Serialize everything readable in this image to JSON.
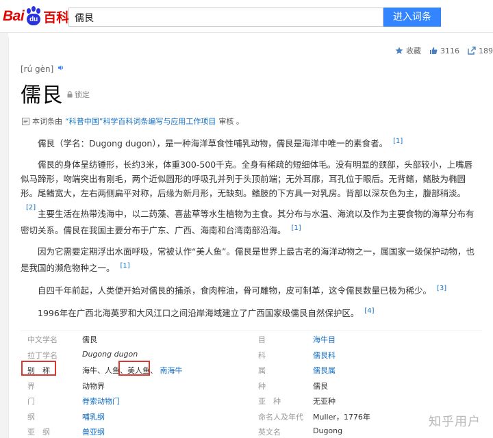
{
  "header": {
    "logo_bai": "Bai",
    "logo_du": "du",
    "logo_ke": "百科",
    "search_value": "儒艮",
    "search_button": "进入词条"
  },
  "actions": {
    "favorite_label": "收藏",
    "like_count": "3116",
    "share_count": "189"
  },
  "entry": {
    "pinyin": "[rú gèn]",
    "title": "儒艮",
    "lock_label": "锁定",
    "source_prefix": "本词条由",
    "source_link": "“科普中国”科学百科词条编写与应用工作项目",
    "source_suffix": "审核 。"
  },
  "paragraphs": [
    {
      "text": "儒艮（学名：Dugong dugon），是一种海洋草食性哺乳动物，儒艮是海洋中唯一的素食者。",
      "ref": "[1]"
    },
    {
      "text": "儒艮的身体呈纺锤形，长约3米，体重300-500千克。全身有稀疏的短细体毛。没有明显的颈部，头部较小，上嘴唇似马蹄形，吻端突出有刚毛，两个近似圆形的呼吸孔并列于头顶前端；无外耳廓，耳孔位于眼后。无背鳍，鳍肢为椭圆形。尾鳍宽大，左右两侧扁平对称，后缘为新月形，无缺刻。鳍肢的下方具一对乳房。背部以深灰色为主，腹部稍淡。",
      "ref": "[2]"
    },
    {
      "text": "主要生活在热带浅海中，以二药藻、喜盐草等水生植物为主食。其分布与水温、海流以及作为主要食物的海草分布有密切关系。儒艮在我国主要分布于广东、广西、海南和台湾南部沿海。",
      "ref": "[1]"
    },
    {
      "text": "因为它需要定期浮出水面呼吸，常被认作“美人鱼”。儒艮是世界上最古老的海洋动物之一，属国家一级保护动物，也是我国的濒危物种之一。",
      "ref": "[1]"
    },
    {
      "text": "自四千年前起，人类便开始对儒艮的捕杀，食肉榨油，骨可雕物，皮可制革，这令儒艮数量已极为稀少。",
      "ref": "[3]"
    },
    {
      "text": "1996年在广西北海英罗和大风江口之间沿岸海域建立了广西国家级儒艮自然保护区。",
      "ref": "[4]"
    }
  ],
  "info_table": {
    "rows": [
      {
        "k1": "中文学名",
        "v1": "儒艮",
        "k2": "目",
        "v2": "海牛目"
      },
      {
        "k1": "拉丁学名",
        "v1": "Dugong dugon",
        "k2": "科",
        "v2": "儒艮科"
      },
      {
        "k1": "别　称",
        "v1a": "海牛、人鱼、",
        "v1b": "美人鱼、",
        "v1c": "南海牛",
        "k2": "属",
        "v2": "儒艮属"
      },
      {
        "k1": "界",
        "v1": "动物界",
        "k2": "种",
        "v2": "儒艮"
      },
      {
        "k1": "门",
        "v1": "脊索动物门",
        "k2": "亚　种",
        "v2": "无亚种"
      },
      {
        "k1": "纲",
        "v1": "哺乳纲",
        "k2": "命名人及年代",
        "v2": "Muller，1776年"
      },
      {
        "k1": "亚　纲",
        "v1": "兽亚纲",
        "k2": "英文名",
        "v2": "Dugong"
      }
    ]
  },
  "watermark": "知乎用户",
  "colors": {
    "brand_red": "#e10602",
    "brand_blue": "#2932e1",
    "link": "#136ec2",
    "button": "#3385ff",
    "highlight_box": "#d9382f"
  }
}
